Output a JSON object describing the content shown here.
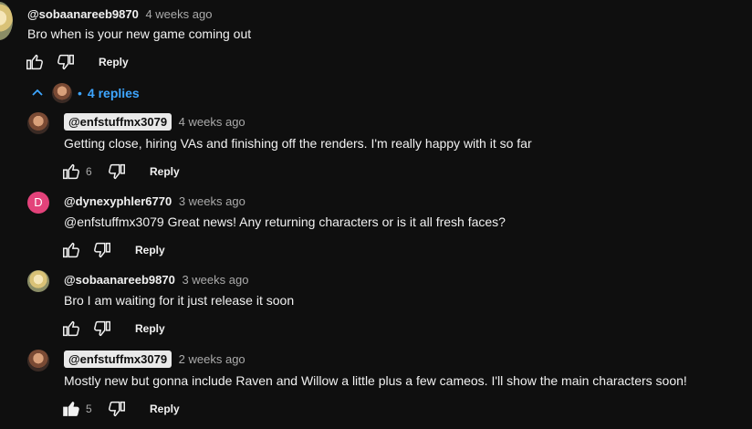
{
  "main_comment": {
    "handle": "@sobaanareeb9870",
    "time": "4 weeks ago",
    "text": "Bro when is your new game coming out",
    "reply_label": "Reply"
  },
  "replies_toggle": {
    "label": "4 replies"
  },
  "replies": [
    {
      "handle": "@enfstuffmx3079",
      "time": "4 weeks ago",
      "text": "Getting close, hiring VAs and finishing off the renders. I'm really happy with it so far",
      "likes": "6",
      "reply_label": "Reply"
    },
    {
      "handle": "@dynexyphler6770",
      "avatar_letter": "D",
      "time": "3 weeks ago",
      "text": "@enfstuffmx3079 Great news! Any returning characters or is it all fresh faces?",
      "reply_label": "Reply"
    },
    {
      "handle": "@sobaanareeb9870",
      "time": "3 weeks ago",
      "text": "Bro I am waiting for it just release it soon",
      "reply_label": "Reply"
    },
    {
      "handle": "@enfstuffmx3079",
      "time": "2 weeks ago",
      "text": "Mostly new but gonna include Raven and Willow a little plus a few cameos. I'll show the main characters soon!",
      "likes": "5",
      "reply_label": "Reply"
    }
  ],
  "colors": {
    "background": "#0f0f0f",
    "link_blue": "#3ea6ff",
    "owner_chip": "#e9e9e9",
    "avatar_d": "#e3427a"
  },
  "icons": [
    "like-icon",
    "dislike-icon",
    "chevron-up-icon"
  ]
}
